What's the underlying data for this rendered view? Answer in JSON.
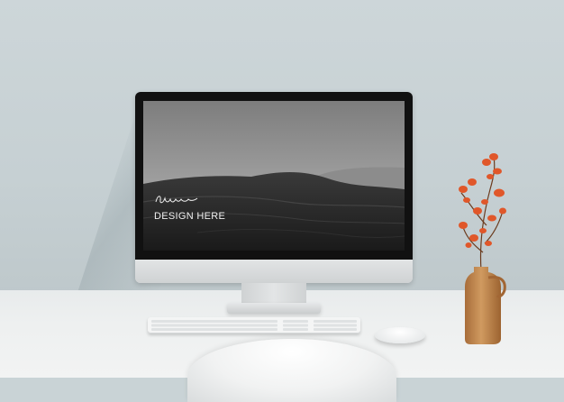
{
  "screen": {
    "script_text": "Your",
    "caption": "DESIGN HERE"
  },
  "colors": {
    "wall": "#c9d3d6",
    "desk": "#eef0f0",
    "bezel": "#111111",
    "vase": "#c98a4e",
    "leaves": "#e0572a"
  },
  "icons": {
    "keyboard": "keyboard-icon",
    "mouse": "mouse-icon"
  }
}
